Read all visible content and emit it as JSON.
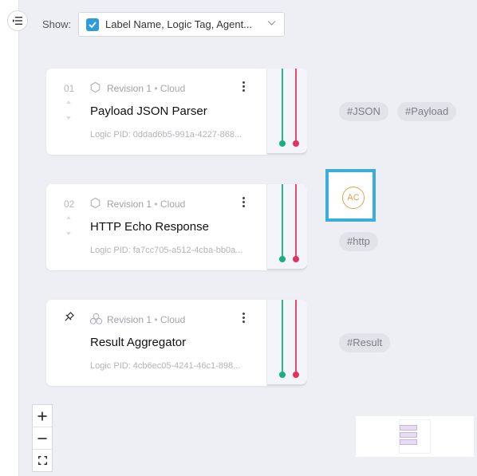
{
  "toolbar": {
    "show_label": "Show:",
    "show_value": "Label Name, Logic Tag, Agent..."
  },
  "colors": {
    "accent": "#2f9cd8",
    "output_ok": "#19b07f",
    "output_err": "#e3335a",
    "agent_border": "#3aaedb"
  },
  "cards": [
    {
      "index": "01",
      "revision": "Revision 1",
      "location": "Cloud",
      "title": "Payload JSON Parser",
      "pid": "Logic PID: 0ddad6b5-991a-4227-868..."
    },
    {
      "index": "02",
      "revision": "Revision 1",
      "location": "Cloud",
      "title": "HTTP Echo Response",
      "pid": "Logic PID: fa7cc705-a512-4cba-bb0a..."
    },
    {
      "index": "",
      "revision": "Revision 1",
      "location": "Cloud",
      "title": "Result Aggregator",
      "pid": "Logic PID: 4cb6ec05-4241-46c1-898..."
    }
  ],
  "tags": {
    "row1": [
      "#JSON",
      "#Payload"
    ],
    "row2": [
      "#http"
    ],
    "row3": [
      "#Result"
    ]
  },
  "agent": {
    "initials": "AC"
  },
  "zoom": {
    "zoom_in_icon": "plus-icon",
    "zoom_out_icon": "minus-icon",
    "fit_icon": "fit-screen-icon"
  }
}
